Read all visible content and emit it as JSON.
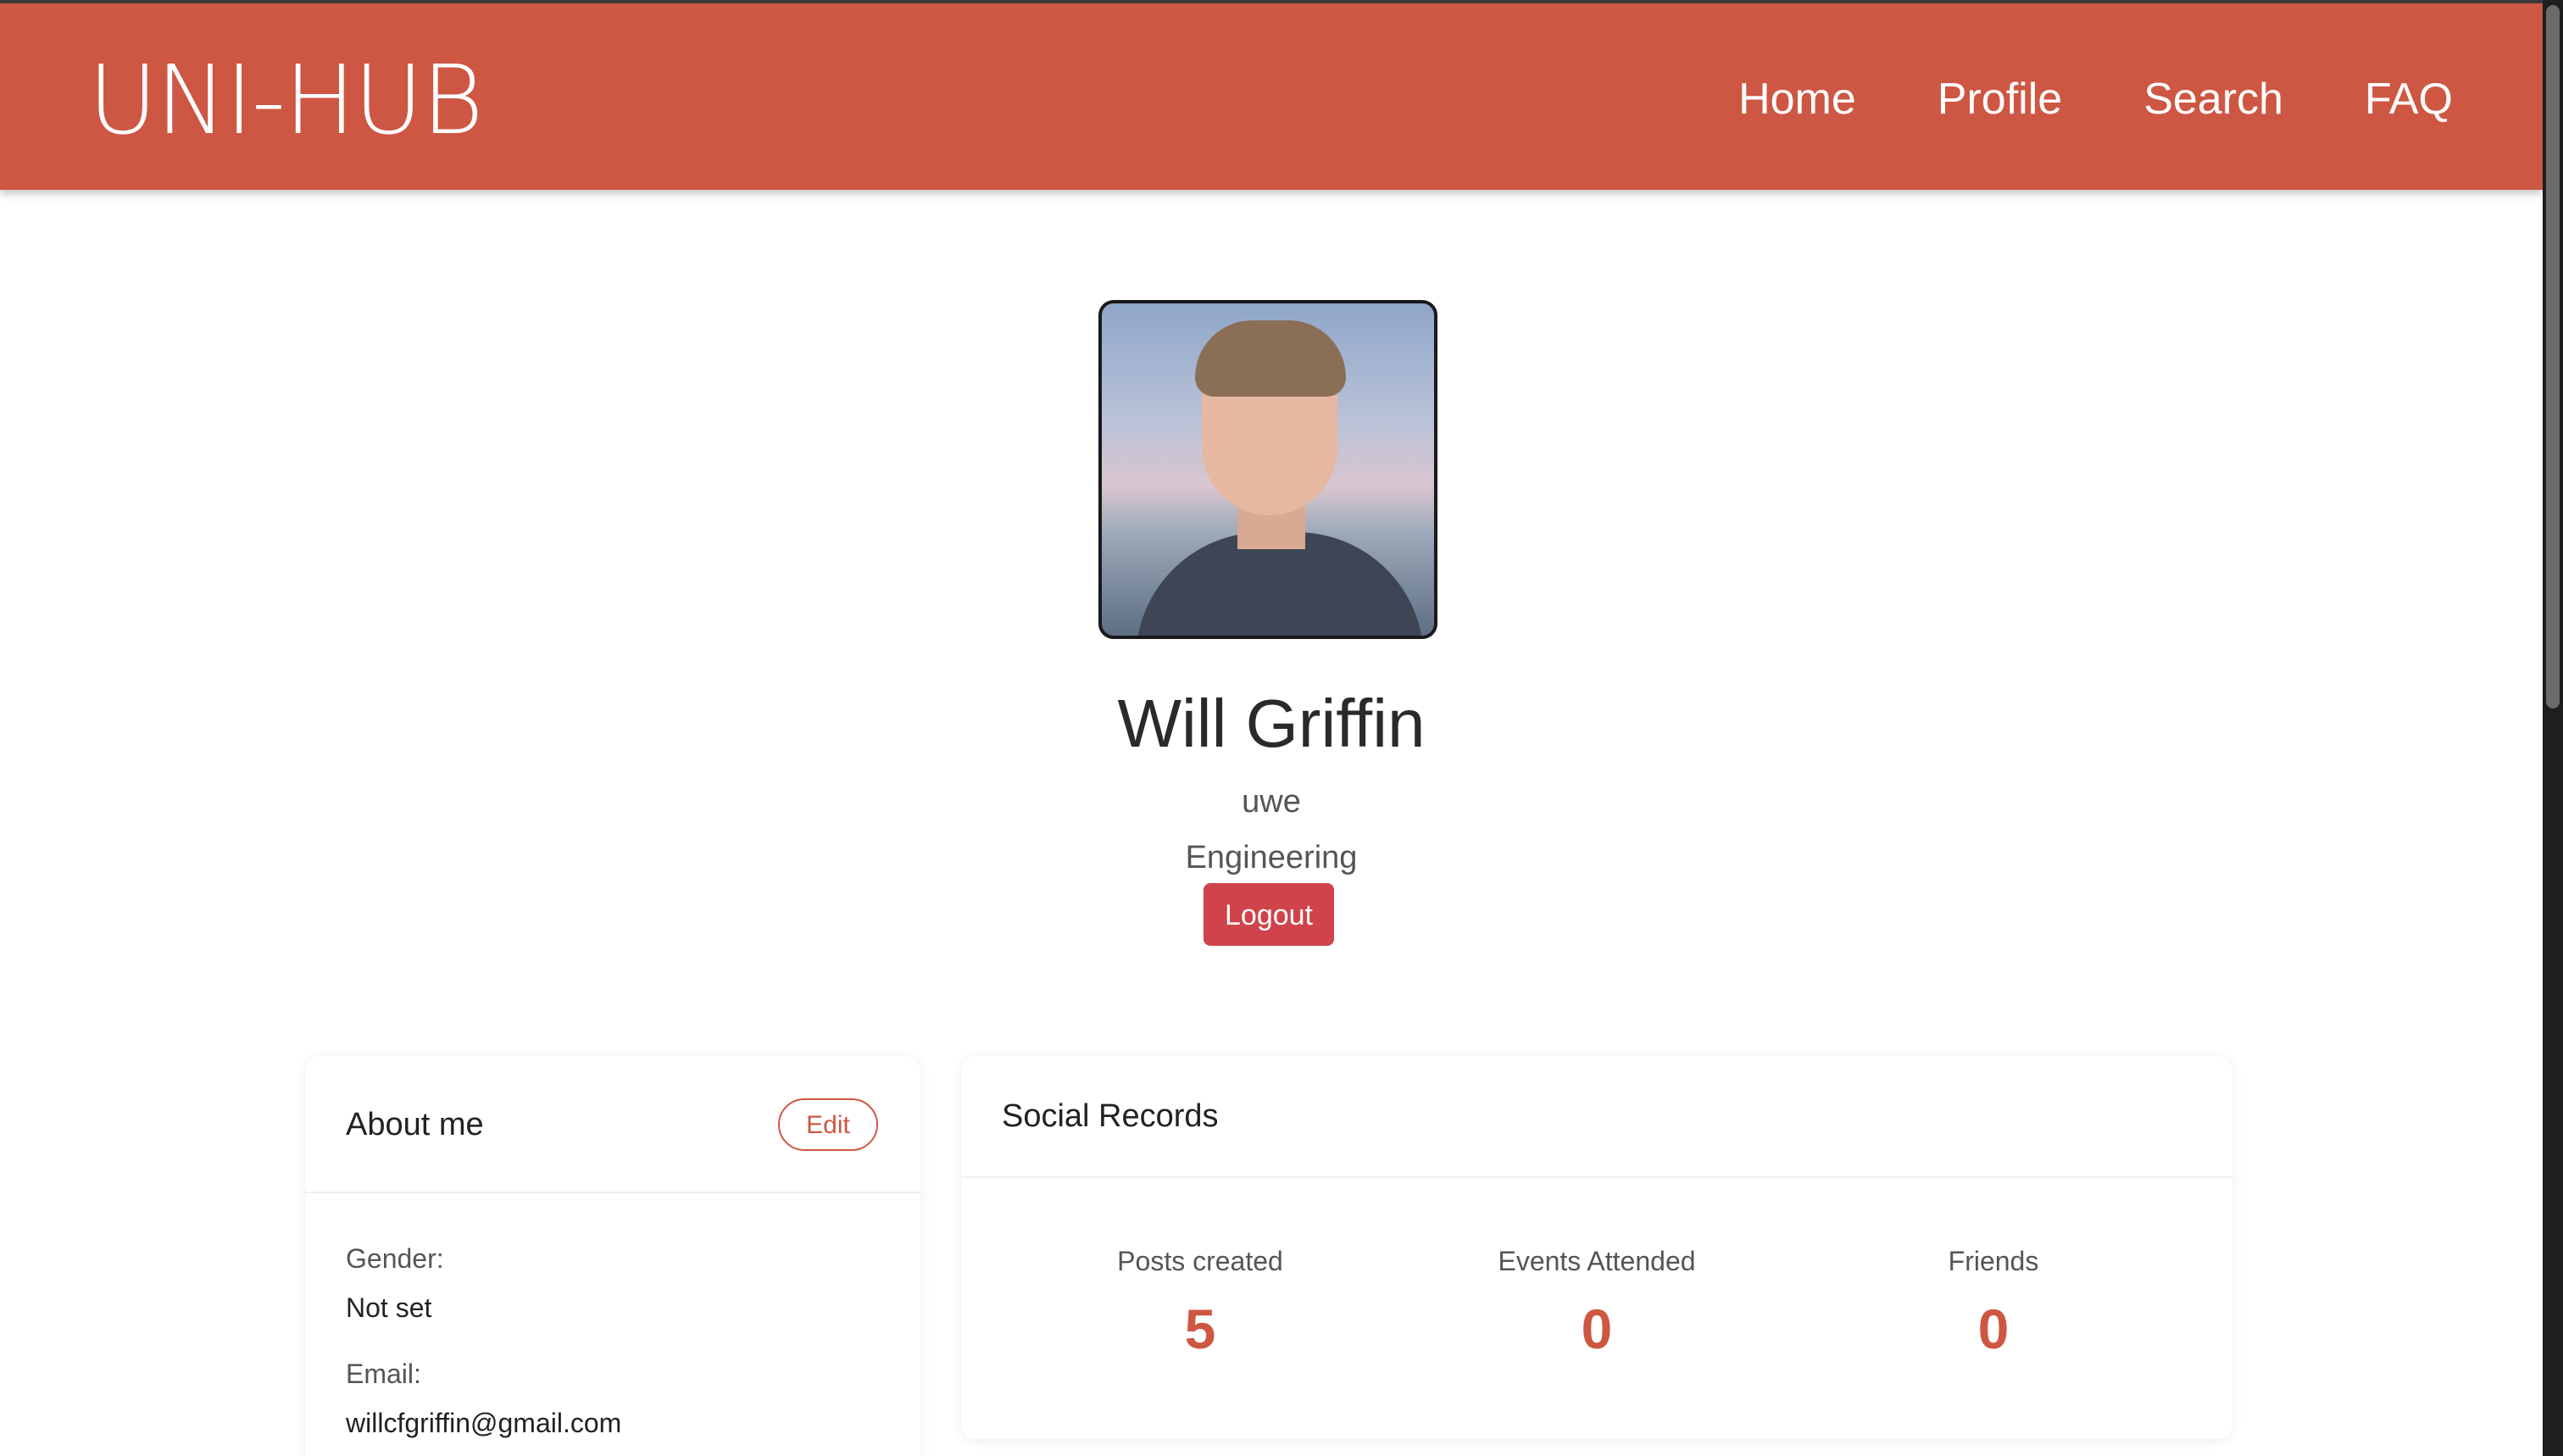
{
  "brand": "UNI-HUB",
  "nav": {
    "items": [
      {
        "label": "Home"
      },
      {
        "label": "Profile"
      },
      {
        "label": "Search"
      },
      {
        "label": "FAQ"
      }
    ]
  },
  "profile": {
    "name": "Will Griffin",
    "university": "uwe",
    "course": "Engineering",
    "logout_label": "Logout"
  },
  "about": {
    "title": "About me",
    "edit_label": "Edit",
    "fields": [
      {
        "label": "Gender:",
        "value": "Not set"
      },
      {
        "label": "Email:",
        "value": "willcfgriffin@gmail.com"
      }
    ]
  },
  "social": {
    "title": "Social Records",
    "stats": [
      {
        "label": "Posts created",
        "value": "5"
      },
      {
        "label": "Events Attended",
        "value": "0"
      },
      {
        "label": "Friends",
        "value": "0"
      }
    ]
  },
  "colors": {
    "accent": "#cd5743",
    "logout": "#d0434a"
  }
}
